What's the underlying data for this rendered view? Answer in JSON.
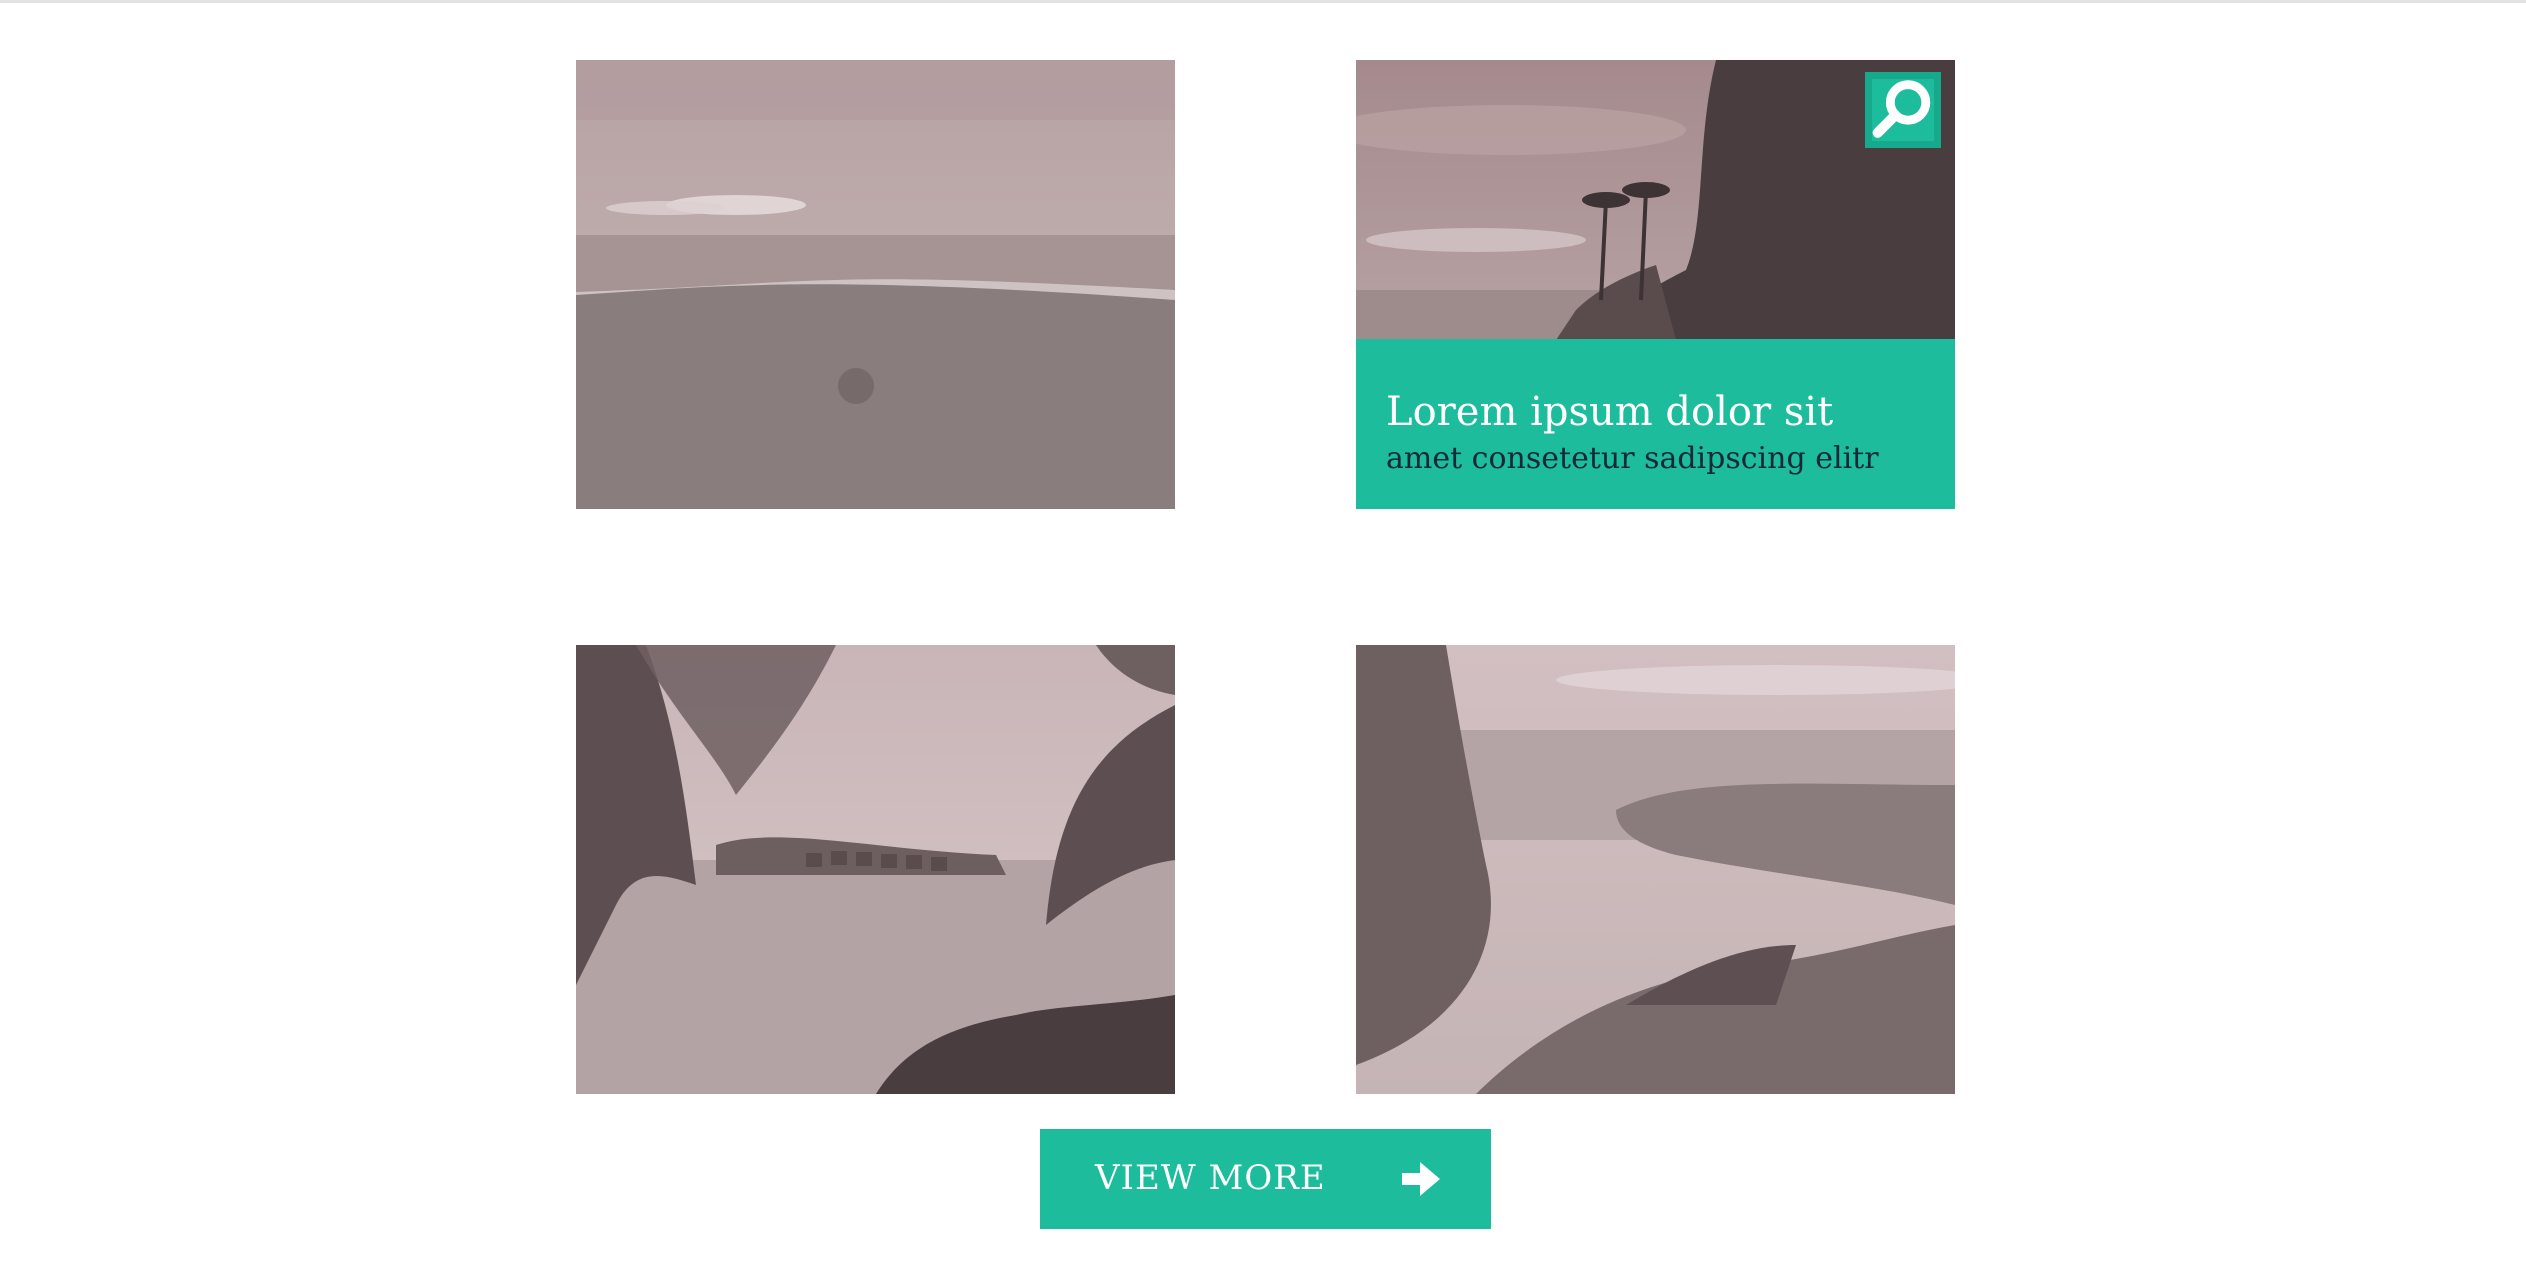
{
  "gallery": {
    "photos": [
      {
        "name": "beach-shore-photo"
      },
      {
        "name": "palm-coast-photo",
        "caption_title": "Lorem ipsum dolor sit",
        "caption_subtitle": "amet consetetur sadipscing elitr",
        "zoom_icon": "search-icon"
      },
      {
        "name": "lagoon-bungalows-photo"
      },
      {
        "name": "river-bay-photo"
      }
    ]
  },
  "view_more": {
    "label": "VIEW MORE",
    "icon": "arrow-right-icon"
  },
  "colors": {
    "accent": "#1cbc9c",
    "accent_dark": "#17a98c",
    "photo_tint": "#b9a3a4",
    "caption_subtitle": "#16283a"
  }
}
